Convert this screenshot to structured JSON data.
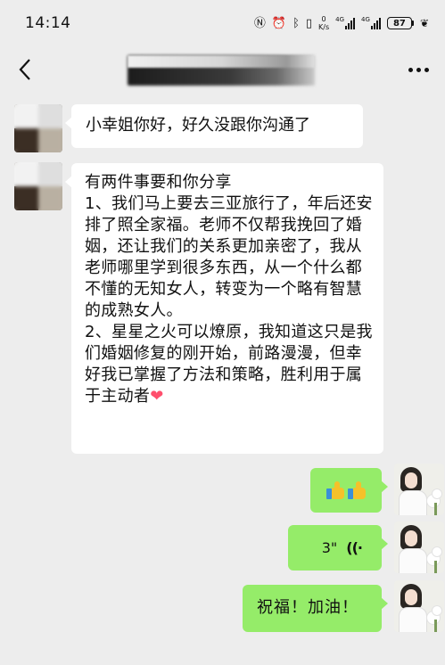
{
  "status_bar": {
    "time": "14:14",
    "net_speed_value": "0",
    "net_speed_unit": "K/s",
    "signal1_label": "4G",
    "signal2_label": "4G",
    "battery": "87",
    "icons": [
      "nfc-icon",
      "alarm-icon",
      "bluetooth-icon",
      "vibrate-icon",
      "signal-icon",
      "signal-icon",
      "battery-icon",
      "leaf-icon"
    ]
  },
  "nav": {
    "back_icon": "chevron-left-icon",
    "title": "",
    "more_icon": "more-icon"
  },
  "messages": [
    {
      "side": "in",
      "type": "text",
      "text": "小幸姐你好，好久没跟你沟通了"
    },
    {
      "side": "in",
      "type": "text",
      "text": "有两件事要和你分享\n1、我们马上要去三亚旅行了，年后还安排了照全家福。老师不仅帮我挽回了婚姻，还让我们的关系更加亲密了，我从老师哪里学到很多东西，从一个什么都不懂的无知女人，转变为一个略有智慧的成熟女人。\n2、星星之火可以燎原，我知道这只是我们婚姻修复的刚开始，前路漫漫，但幸好我已掌握了方法和策略，胜利用于属于主动者",
      "emoji": "heart-emoji"
    },
    {
      "side": "out",
      "type": "emoji",
      "emoji": [
        "thumbs-up-emoji",
        "thumbs-up-emoji"
      ]
    },
    {
      "side": "out",
      "type": "voice",
      "duration": "3\""
    },
    {
      "side": "out",
      "type": "text",
      "text": "祝福！加油！"
    }
  ],
  "colors": {
    "background": "#ededed",
    "incoming_bubble": "#ffffff",
    "outgoing_bubble": "#95ec69"
  }
}
